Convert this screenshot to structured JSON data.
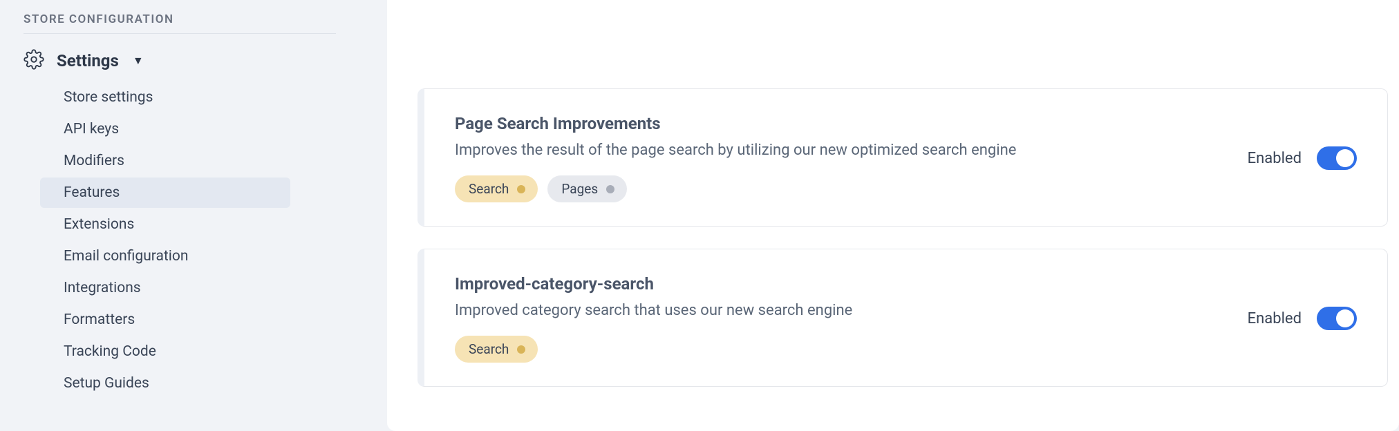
{
  "sidebar": {
    "section_title": "STORE CONFIGURATION",
    "settings_label": "Settings",
    "items": [
      {
        "label": "Store settings",
        "active": false
      },
      {
        "label": "API keys",
        "active": false
      },
      {
        "label": "Modifiers",
        "active": false
      },
      {
        "label": "Features",
        "active": true
      },
      {
        "label": "Extensions",
        "active": false
      },
      {
        "label": "Email configuration",
        "active": false
      },
      {
        "label": "Integrations",
        "active": false
      },
      {
        "label": "Formatters",
        "active": false
      },
      {
        "label": "Tracking Code",
        "active": false
      },
      {
        "label": "Setup Guides",
        "active": false
      }
    ]
  },
  "features": {
    "enabled_label": "Enabled",
    "items": [
      {
        "title": "Page Search Improvements",
        "description": "Improves the result of the page search by utilizing our new optimized search engine",
        "tags": [
          {
            "label": "Search",
            "color": "amber"
          },
          {
            "label": "Pages",
            "color": "gray"
          }
        ],
        "enabled": true
      },
      {
        "title": "Improved-category-search",
        "description": "Improved category search that uses our new search engine",
        "tags": [
          {
            "label": "Search",
            "color": "amber"
          }
        ],
        "enabled": true
      }
    ]
  }
}
